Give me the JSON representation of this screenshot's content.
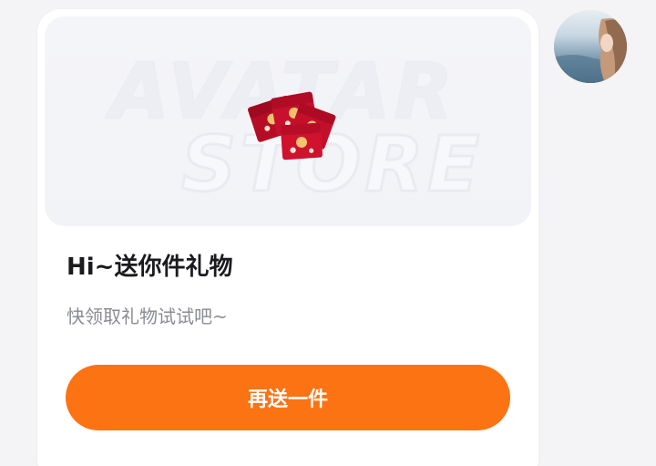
{
  "banner": {
    "watermark_line1": "AVATAR",
    "watermark_line2": "STORE",
    "gift_icon": "red-envelopes-icon"
  },
  "card": {
    "title": "Hi~送你件礼物",
    "subtitle": "快领取礼物试试吧~",
    "send_button_label": "再送一件"
  },
  "colors": {
    "accent": "#fc7313",
    "background": "#f4f4f6",
    "card": "#ffffff",
    "envelope_red": "#c8102e"
  },
  "avatar": {
    "icon": "user-avatar-icon"
  }
}
